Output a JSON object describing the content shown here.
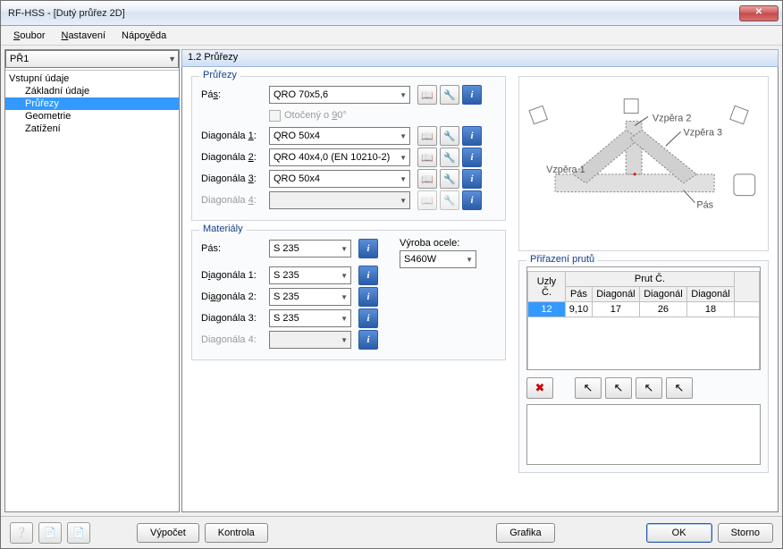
{
  "window": {
    "title": "RF-HSS - [Dutý průřez 2D]"
  },
  "menu": {
    "soubor": "Soubor",
    "nastaveni": "Nastavení",
    "napoveda": "Nápověda"
  },
  "case_selector": "PŘ1",
  "tree": {
    "root": "Vstupní údaje",
    "items": [
      "Základní údaje",
      "Průřezy",
      "Geometrie",
      "Zatížení"
    ],
    "selected_index": 1
  },
  "section_header": "1.2 Průřezy",
  "prurezy": {
    "legend": "Průřezy",
    "labels": {
      "pas": "Pás:",
      "d1": "Diagonála 1:",
      "d2": "Diagonála 2:",
      "d3": "Diagonála 3:",
      "d4": "Diagonála 4:"
    },
    "pas": "QRO 70x5,6",
    "otoceny": "Otočený o 90°",
    "d1": "QRO 50x4",
    "d2": "QRO 40x4,0 (EN 10210-2)",
    "d3": "QRO 50x4",
    "d4": ""
  },
  "materialy": {
    "legend": "Materiály",
    "labels": {
      "pas": "Pás:",
      "d1": "Diagonála 1:",
      "d2": "Diagonála 2:",
      "d3": "Diagonála 3:",
      "d4": "Diagonála 4:"
    },
    "pas": "S 235",
    "d1": "S 235",
    "d2": "S 235",
    "d3": "S 235",
    "d4": "",
    "vyroba_label": "Výroba ocele:",
    "vyroba": "S460W"
  },
  "preview_labels": {
    "vzpera1": "Vzpěra 1",
    "vzpera2": "Vzpěra 2",
    "vzpera3": "Vzpěra 3",
    "pas": "Pás"
  },
  "prirazeni": {
    "legend": "Přiřazení prutů",
    "hdr_uzly": "Uzly Č.",
    "hdr_prut": "Prut Č.",
    "cols": [
      "Pás",
      "Diagonál",
      "Diagonál",
      "Diagonál"
    ],
    "row": {
      "uzel": "12",
      "pas": "9,10",
      "d1": "17",
      "d2": "26",
      "d3": "18"
    }
  },
  "footer": {
    "vypocet": "Výpočet",
    "kontrola": "Kontrola",
    "grafika": "Grafika",
    "ok": "OK",
    "storno": "Storno"
  }
}
